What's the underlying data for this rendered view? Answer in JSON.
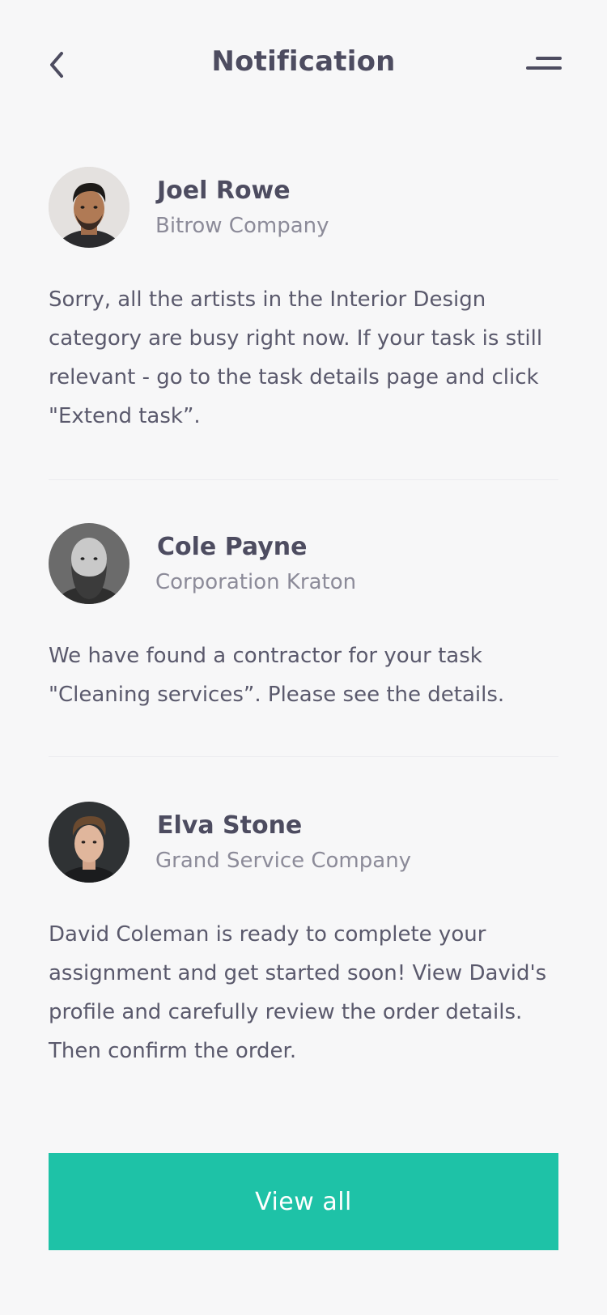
{
  "header": {
    "title": "Notification",
    "back_icon": "chevron-left-icon",
    "menu_icon": "menu-lines-icon"
  },
  "notifications": [
    {
      "name": "Joel Rowe",
      "company": "Bitrow Company",
      "message": "Sorry, all the artists in the Interior Design category are busy right now. If your task is still relevant - go to the task details page and click \"Extend task”."
    },
    {
      "name": "Cole Payne",
      "company": "Corporation Kraton",
      "message": "We have found a contractor for your task \"Cleaning services”. Please see the details."
    },
    {
      "name": "Elva Stone",
      "company": "Grand Service Company",
      "message": "David Coleman is ready to complete your assignment and get started soon! View David's profile and carefully review the order details. Then confirm the order."
    }
  ],
  "actions": {
    "view_all_label": "View all"
  },
  "colors": {
    "accent": "#1ec2a7",
    "text_primary": "#4d4c60",
    "text_secondary": "#8c8b99",
    "background": "#f7f7f8"
  }
}
